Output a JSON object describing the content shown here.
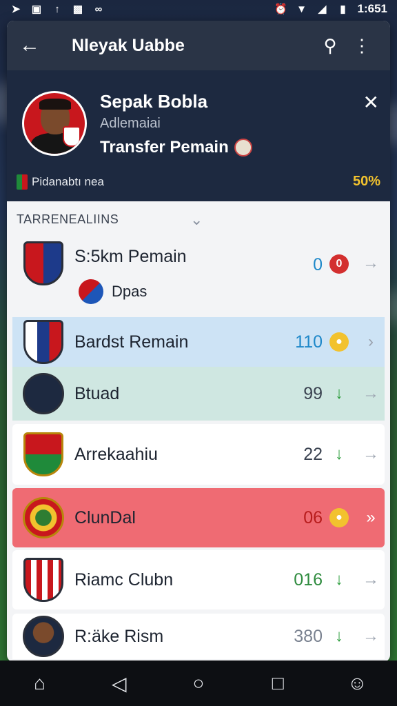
{
  "status_bar": {
    "time": "1:651",
    "left_icons": [
      "navigation-icon",
      "gallery-icon",
      "upload-icon",
      "cast-icon",
      "link-icon"
    ],
    "right_icons": [
      "alarm-icon",
      "wifi-icon",
      "signal-icon",
      "battery-icon"
    ]
  },
  "app_bar": {
    "title": "Nleyak Uabbe"
  },
  "profile": {
    "name": "Sepak Bobla",
    "subtitle": "Adlemaiai",
    "transfer_label": "Transfer Pemain",
    "footer_label": "Pidanabtı nea",
    "percent": "50%"
  },
  "section": {
    "title": "TARRENEALIINS"
  },
  "rows": [
    {
      "name": "S:5km Pemain",
      "value": "0",
      "value_color": "#1e88c9",
      "status_color": "#d32f2f",
      "sub_label": "Dpas"
    },
    {
      "name": "Bardst Remain",
      "value": "110",
      "value_color": "#1e88c9",
      "status_color": "#f2c22e"
    },
    {
      "name": "Btuad",
      "value": "99",
      "value_color": "#3a4250",
      "status_color": "#2e9e3e"
    },
    {
      "name": "Arrekaahiu",
      "value": "22",
      "value_color": "#3a4250",
      "status_color": "#2e9e3e"
    },
    {
      "name": "ClunDal",
      "value": "06",
      "value_color": "#b71c1c",
      "status_color": "#f2c22e"
    },
    {
      "name": "Riamc Clubn",
      "value": "016",
      "value_color": "#2e8b3e",
      "status_color": "#2e9e3e"
    },
    {
      "name": "R:äke Rism",
      "value": "380",
      "value_color": "#7a8290",
      "status_color": "#2e9e3e"
    }
  ],
  "colors": {
    "app_bar": "#2a3446",
    "profile_bg": "#1d2940",
    "row_highlight_blue": "#cde3f5",
    "row_highlight_teal": "#cfe7e1",
    "row_highlight_red": "#ef6b73",
    "accent_yellow": "#f2c22e"
  },
  "nav": {
    "items": [
      "home-icon",
      "back-icon",
      "home-circle-icon",
      "recents-icon",
      "profile-icon"
    ]
  }
}
